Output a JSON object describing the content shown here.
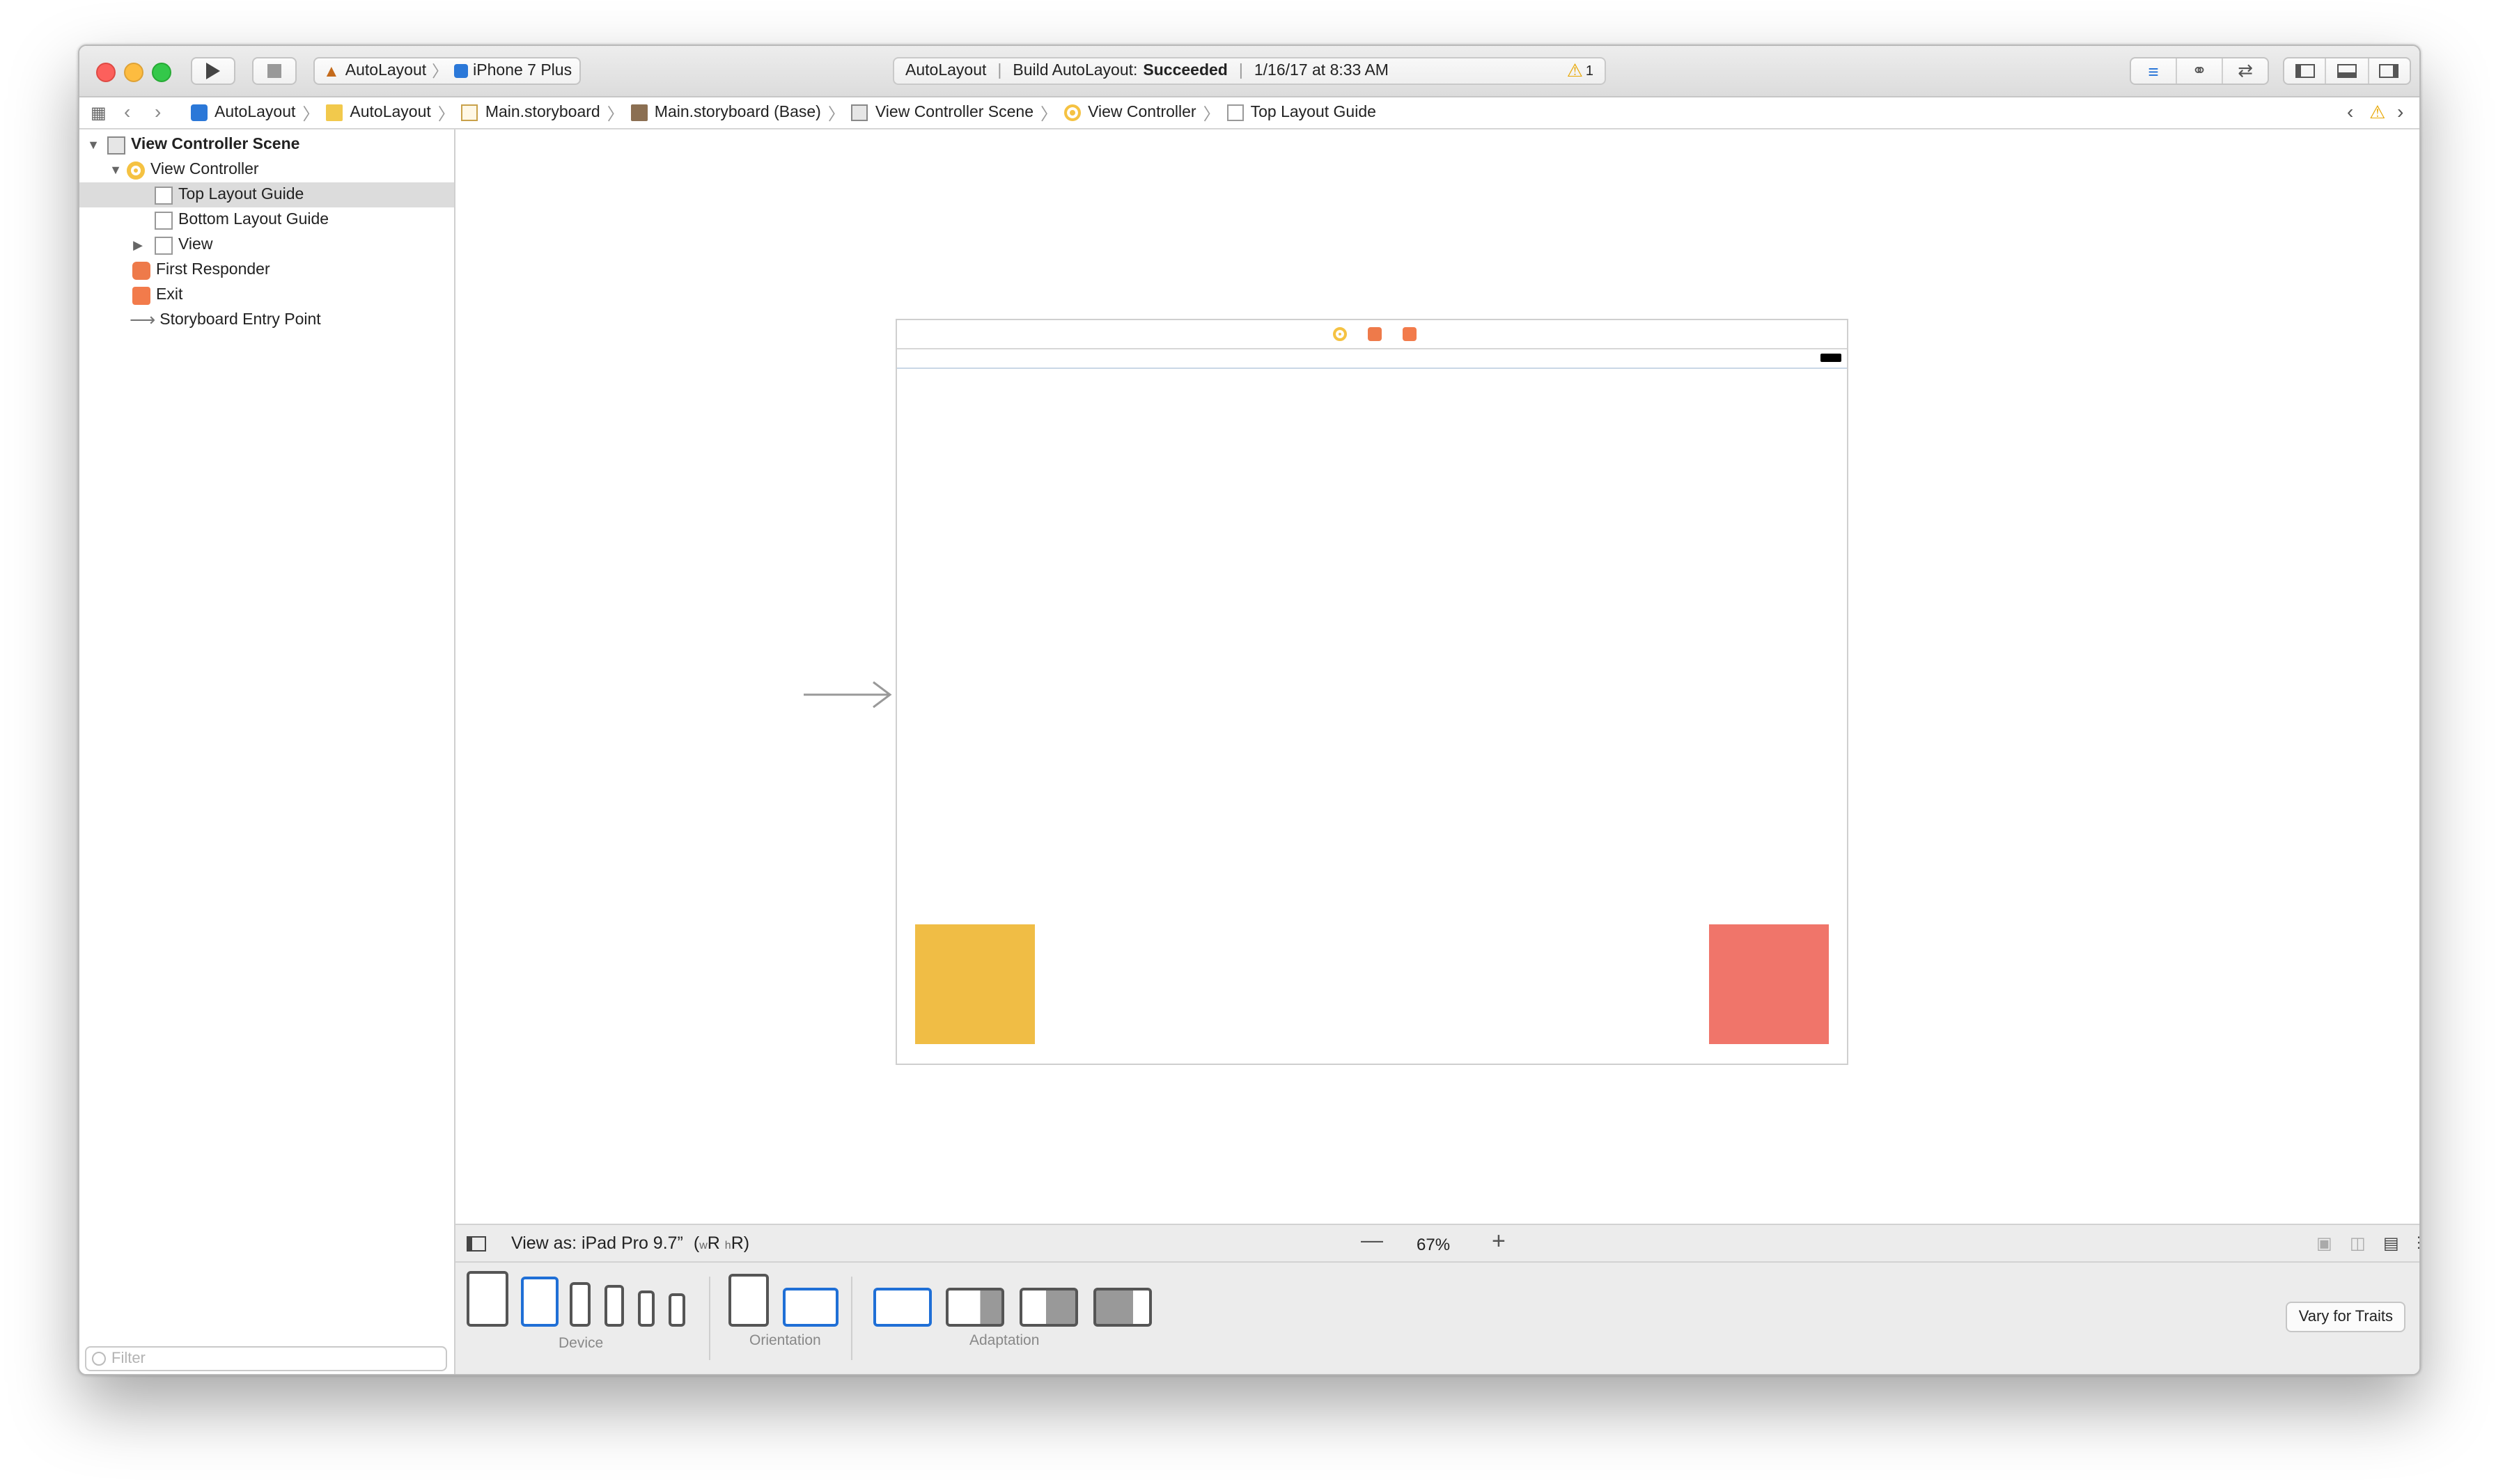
{
  "toolbar": {
    "scheme_project": "AutoLayout",
    "scheme_device": "iPhone 7 Plus",
    "activity_project": "AutoLayout",
    "activity_status_prefix": "Build AutoLayout:",
    "activity_status": "Succeeded",
    "activity_time": "1/16/17 at 8:33 AM",
    "warning_count": "1"
  },
  "jumpbar": {
    "crumbs": [
      "AutoLayout",
      "AutoLayout",
      "Main.storyboard",
      "Main.storyboard (Base)",
      "View Controller Scene",
      "View Controller",
      "Top Layout Guide"
    ]
  },
  "navigator": {
    "scene": "View Controller Scene",
    "view_controller": "View Controller",
    "top_layout_guide": "Top Layout Guide",
    "bottom_layout_guide": "Bottom Layout Guide",
    "view": "View",
    "first_responder": "First Responder",
    "exit": "Exit",
    "entry_point": "Storyboard Entry Point",
    "filter_placeholder": "Filter"
  },
  "viewas": {
    "label": "View as: iPad Pro 9.7”",
    "size_class_prefix": "(",
    "w": "w",
    "wR": "R ",
    "h": "h",
    "hR": "R)",
    "zoom": "67%"
  },
  "traits": {
    "device_label": "Device",
    "orientation_label": "Orientation",
    "adaptation_label": "Adaptation",
    "vary_button": "Vary for Traits"
  },
  "colors": {
    "yellow_box": "#f0bd45",
    "red_box": "#f0756a",
    "selection_blue": "#1f6fd6"
  }
}
